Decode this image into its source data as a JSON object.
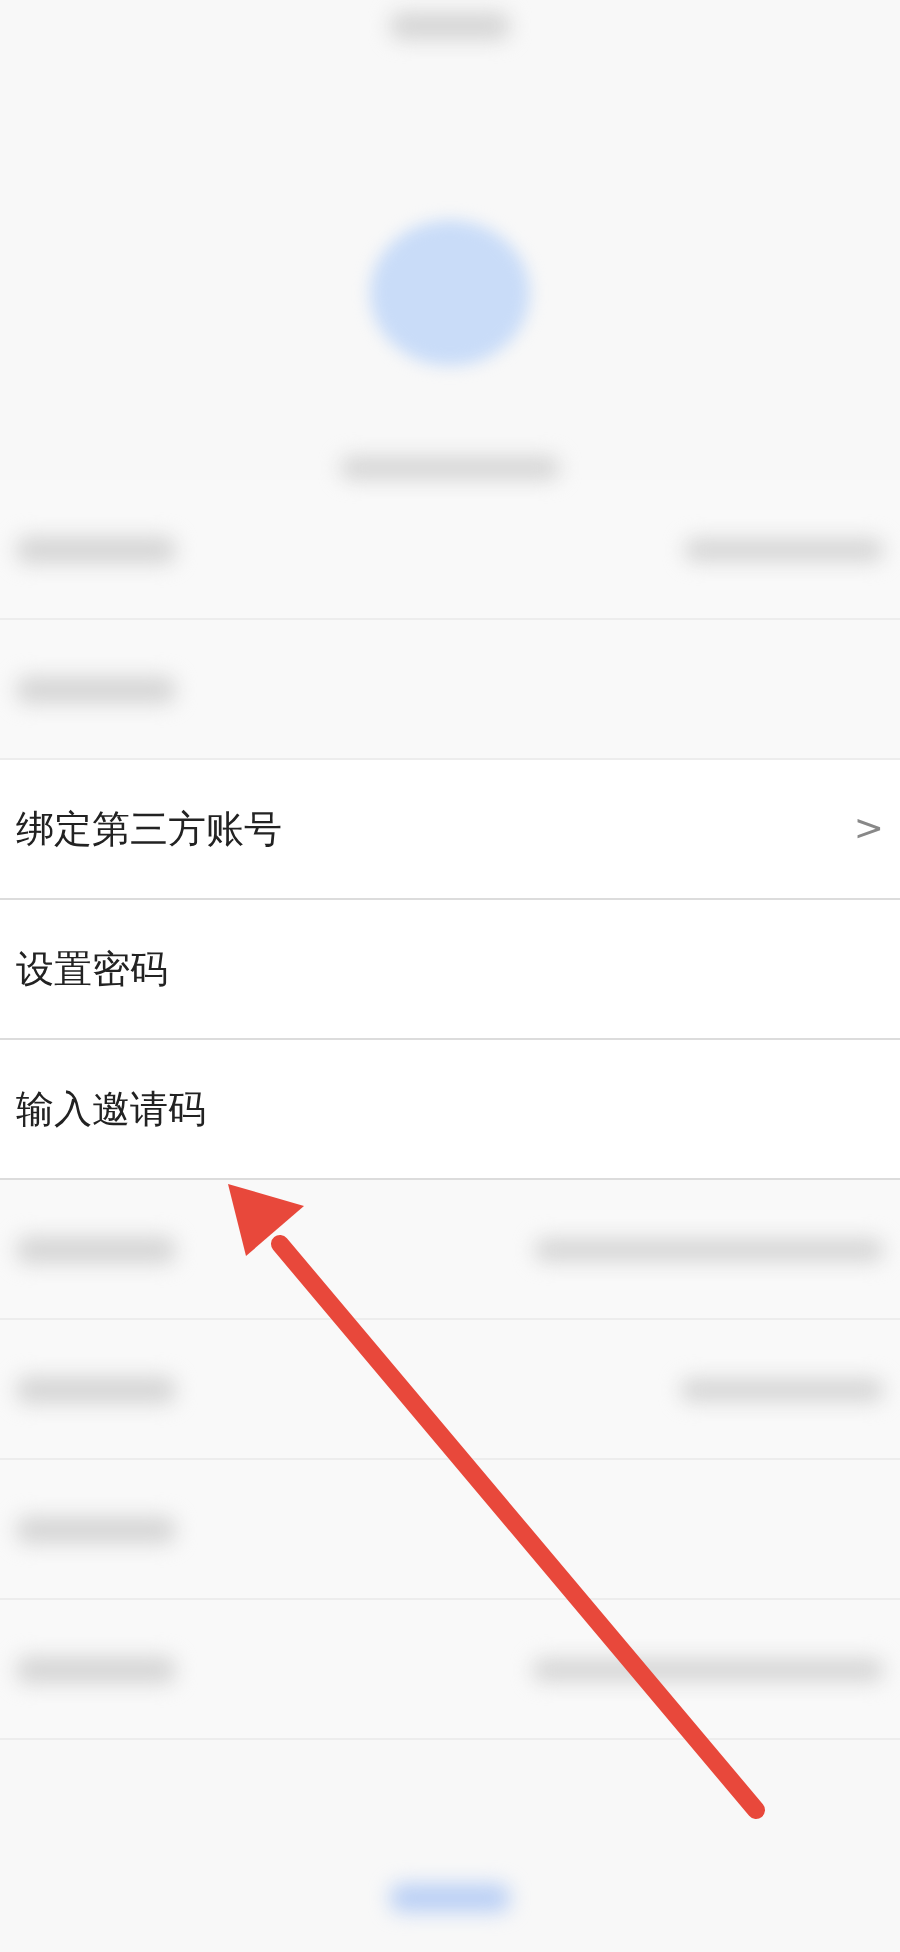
{
  "rows": [
    {
      "kind": "blurred"
    },
    {
      "kind": "blurred"
    },
    {
      "kind": "item",
      "label": "绑定第三方账号",
      "chevron": ">"
    },
    {
      "kind": "item",
      "label": "设置密码"
    },
    {
      "kind": "item",
      "label": "输入邀请码"
    },
    {
      "kind": "blurred"
    },
    {
      "kind": "blurred"
    },
    {
      "kind": "blurred"
    },
    {
      "kind": "blurred"
    }
  ]
}
